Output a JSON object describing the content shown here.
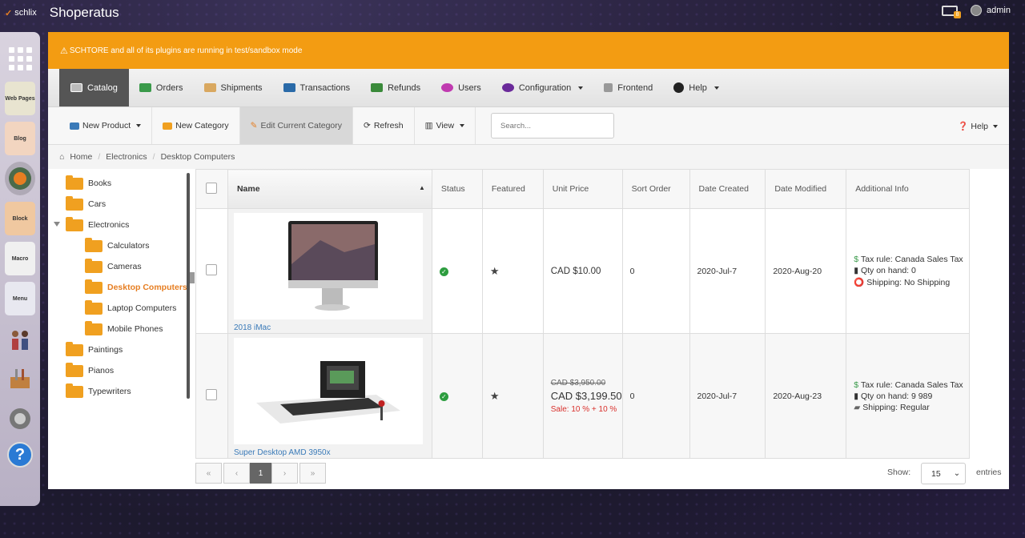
{
  "topbar": {
    "brand": "schlix",
    "app_title": "Shoperatus",
    "tray_badge": "8",
    "user": "admin"
  },
  "dock": {
    "items": [
      "Web Pages",
      "Blog",
      "Block",
      "Macro",
      "Menu"
    ]
  },
  "alert": {
    "text": "SCHTORE and all of its plugins are running in test/sandbox mode"
  },
  "nav": [
    {
      "label": "Catalog",
      "icon": "catalog-icon",
      "active": true
    },
    {
      "label": "Orders",
      "icon": "orders-icon"
    },
    {
      "label": "Shipments",
      "icon": "truck-icon"
    },
    {
      "label": "Transactions",
      "icon": "transactions-icon"
    },
    {
      "label": "Refunds",
      "icon": "refunds-icon"
    },
    {
      "label": "Users",
      "icon": "users-icon"
    },
    {
      "label": "Configuration",
      "icon": "gears-icon"
    },
    {
      "label": "Frontend",
      "icon": "frontend-icon"
    },
    {
      "label": "Help",
      "icon": "question-icon"
    }
  ],
  "toolbar": {
    "new_product": "New Product",
    "new_category": "New Category",
    "edit_category": "Edit Current Category",
    "refresh": "Refresh",
    "view": "View",
    "search_placeholder": "Search...",
    "help": "Help"
  },
  "breadcrumb": [
    "Home",
    "Electronics",
    "Desktop Computers"
  ],
  "tree": [
    "Books",
    "Cars",
    "Electronics",
    "Calculators",
    "Cameras",
    "Desktop Computers",
    "Laptop Computers",
    "Mobile Phones",
    "Paintings",
    "Pianos",
    "Typewriters"
  ],
  "table": {
    "headers": [
      "Name",
      "Status",
      "Featured",
      "Unit Price",
      "Sort Order",
      "Date Created",
      "Date Modified",
      "Additional Info"
    ],
    "rows": [
      {
        "name": "2018 iMac",
        "price": "CAD $10.00",
        "sort": "0",
        "created": "2020-Jul-7",
        "modified": "2020-Aug-20",
        "info": [
          "Tax rule: Canada Sales Tax",
          "Qty on hand: 0",
          "Shipping: No Shipping"
        ]
      },
      {
        "name": "Super Desktop AMD 3950x",
        "old_price": "CAD $3,950.00",
        "price": "CAD $3,199.50",
        "sale": "Sale: 10 % + 10 %",
        "sort": "0",
        "created": "2020-Jul-7",
        "modified": "2020-Aug-23",
        "info": [
          "Tax rule: Canada Sales Tax",
          "Qty on hand: 9 989",
          "Shipping: Regular"
        ]
      }
    ]
  },
  "pager": {
    "first": "«",
    "prev": "‹",
    "current": "1",
    "next": "›",
    "last": "»"
  },
  "footer": {
    "show": "Show:",
    "per_page": "15",
    "entries": "entries"
  },
  "colors": {
    "alert": "#f39c12",
    "active_nav": "#555555",
    "selected_category": "#e67e22",
    "link": "#3a7ab8",
    "sale": "#d9302c",
    "status_ok": "#2d9d3f"
  }
}
